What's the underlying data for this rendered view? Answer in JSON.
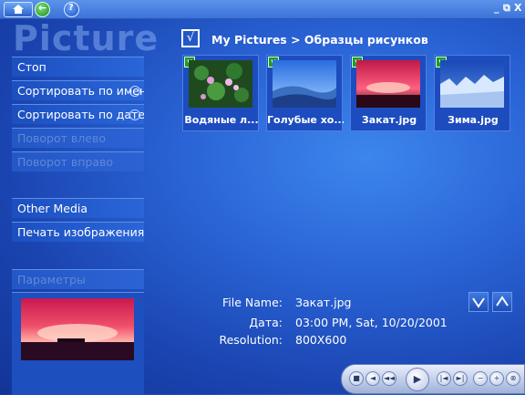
{
  "topbar": {
    "icons": [
      "home-icon",
      "back-icon",
      "help-icon"
    ],
    "help_glyph": "?",
    "window_controls": {
      "minimize": "_",
      "restore": "⧉",
      "close": "X"
    }
  },
  "title": "Picture",
  "sidebar": {
    "items": [
      {
        "label": "Стоп",
        "enabled": true
      },
      {
        "label": "Сортировать по имени",
        "enabled": true
      },
      {
        "label": "Сортировать по дате",
        "enabled": true
      },
      {
        "label": "Поворот влево",
        "enabled": false
      },
      {
        "label": "Поворот вправо",
        "enabled": false
      }
    ],
    "other": [
      {
        "label": "Other Media",
        "enabled": true
      },
      {
        "label": "Печать изображения",
        "enabled": true
      }
    ],
    "params": {
      "label": "Параметры",
      "enabled": false
    }
  },
  "breadcrumb": {
    "check": "√",
    "path": "My Pictures > Образцы рисунков"
  },
  "thumbnails": [
    {
      "caption": "Водяные л...",
      "checked": true
    },
    {
      "caption": "Голубые хо...",
      "checked": true
    },
    {
      "caption": "Закат.jpg",
      "checked": true
    },
    {
      "caption": "Зима.jpg",
      "checked": true
    }
  ],
  "details": {
    "file_name_label": "File Name:",
    "file_name": "Закат.jpg",
    "date_label": "Дата:",
    "date": "03:00 PM, Sat, 10/20/2001",
    "resolution_label": "Resolution:",
    "resolution": "800X600"
  },
  "transport": [
    "stop-icon",
    "previous-icon",
    "rewind-icon",
    "play-icon",
    "skip-back-icon",
    "skip-forward-icon",
    "volume-down-icon",
    "volume-up-icon",
    "mute-icon"
  ],
  "colors": {
    "accent": "#2a64d6",
    "panel": "#1d4cbf",
    "disabled_text": "#5f88d8"
  }
}
